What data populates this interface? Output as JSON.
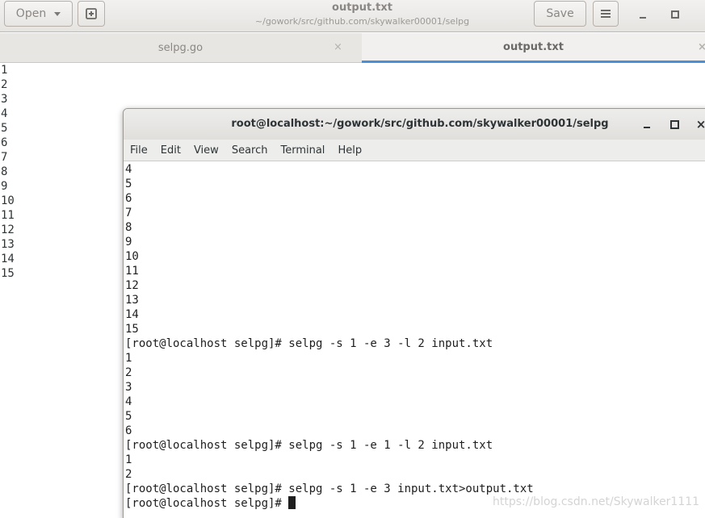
{
  "gedit": {
    "open_label": "Open",
    "title": "output.txt",
    "subtitle": "~/gowork/src/github.com/skywalker00001/selpg",
    "save_label": "Save",
    "tabs": [
      {
        "label": "selpg.go",
        "close": "×"
      },
      {
        "label": "output.txt",
        "close": "×"
      }
    ],
    "lines": [
      "1",
      "2",
      "3",
      "4",
      "5",
      "6",
      "7",
      "8",
      "9",
      "10",
      "11",
      "12",
      "13",
      "14",
      "15"
    ]
  },
  "terminal": {
    "title": "root@localhost:~/gowork/src/github.com/skywalker00001/selpg",
    "close": "×",
    "menu": [
      "File",
      "Edit",
      "View",
      "Search",
      "Terminal",
      "Help"
    ],
    "lines": [
      "4",
      "5",
      "6",
      "7",
      "8",
      "9",
      "10",
      "11",
      "12",
      "13",
      "14",
      "15",
      "[root@localhost selpg]# selpg -s 1 -e 3 -l 2 input.txt",
      "1",
      "2",
      "3",
      "4",
      "5",
      "6",
      "[root@localhost selpg]# selpg -s 1 -e 1 -l 2 input.txt",
      "1",
      "2",
      "[root@localhost selpg]# selpg -s 1 -e 3 input.txt>output.txt"
    ],
    "prompt": "[root@localhost selpg]# "
  },
  "watermark": "https://blog.csdn.net/Skywalker1111",
  "colors": {
    "tab_accent": "#4a90d9"
  }
}
